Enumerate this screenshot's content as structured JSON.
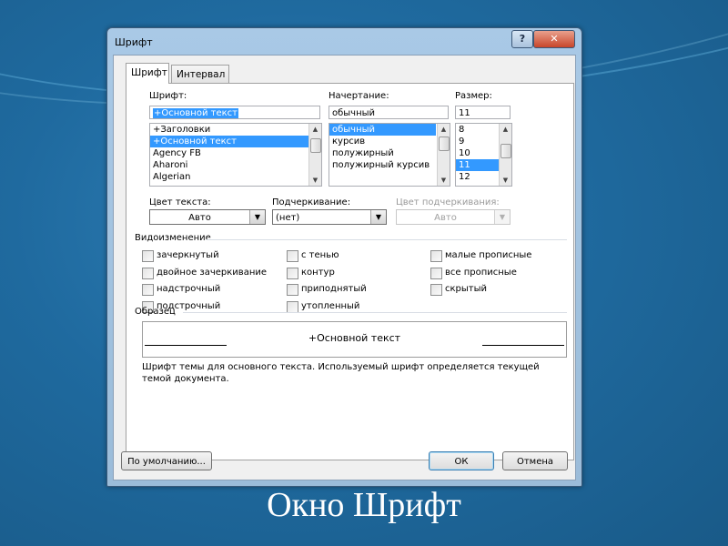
{
  "window": {
    "title": "Шрифт",
    "help_label": "?",
    "close_label": "✕"
  },
  "tabs": [
    {
      "label": "Шрифт",
      "active": true
    },
    {
      "label": "Интервал",
      "active": false
    }
  ],
  "font": {
    "label": "Шрифт:",
    "value": "+Основной текст",
    "items": [
      "+Заголовки",
      "+Основной текст",
      "Agency FB",
      "Aharoni",
      "Algerian"
    ],
    "selected_index": 1
  },
  "style": {
    "label": "Начертание:",
    "value": "обычный",
    "items": [
      "обычный",
      "курсив",
      "полужирный",
      "полужирный курсив"
    ],
    "selected_index": 0
  },
  "size": {
    "label": "Размер:",
    "value": "11",
    "items": [
      "8",
      "9",
      "10",
      "11",
      "12"
    ],
    "selected_index": 3
  },
  "text_color": {
    "label": "Цвет текста:",
    "value": "Авто"
  },
  "underline": {
    "label": "Подчеркивание:",
    "value": "(нет)"
  },
  "underline_color": {
    "label": "Цвет подчеркивания:",
    "value": "Авто"
  },
  "effects": {
    "group_label": "Видоизменение",
    "col1": [
      "зачеркнутый",
      "двойное зачеркивание",
      "надстрочный",
      "подстрочный"
    ],
    "col2": [
      "с тенью",
      "контур",
      "приподнятый",
      "утопленный"
    ],
    "col3": [
      "малые прописные",
      "все прописные",
      "скрытый"
    ]
  },
  "sample": {
    "group_label": "Образец",
    "text": "+Основной текст",
    "note": "Шрифт темы для основного текста. Используемый шрифт определяется текущей темой документа."
  },
  "buttons": {
    "default": "По умолчанию...",
    "ok": "ОК",
    "cancel": "Отмена"
  },
  "caption": "Окно Шрифт",
  "colors": {
    "selection": "#3399ff",
    "background": "#1f6a9f"
  }
}
